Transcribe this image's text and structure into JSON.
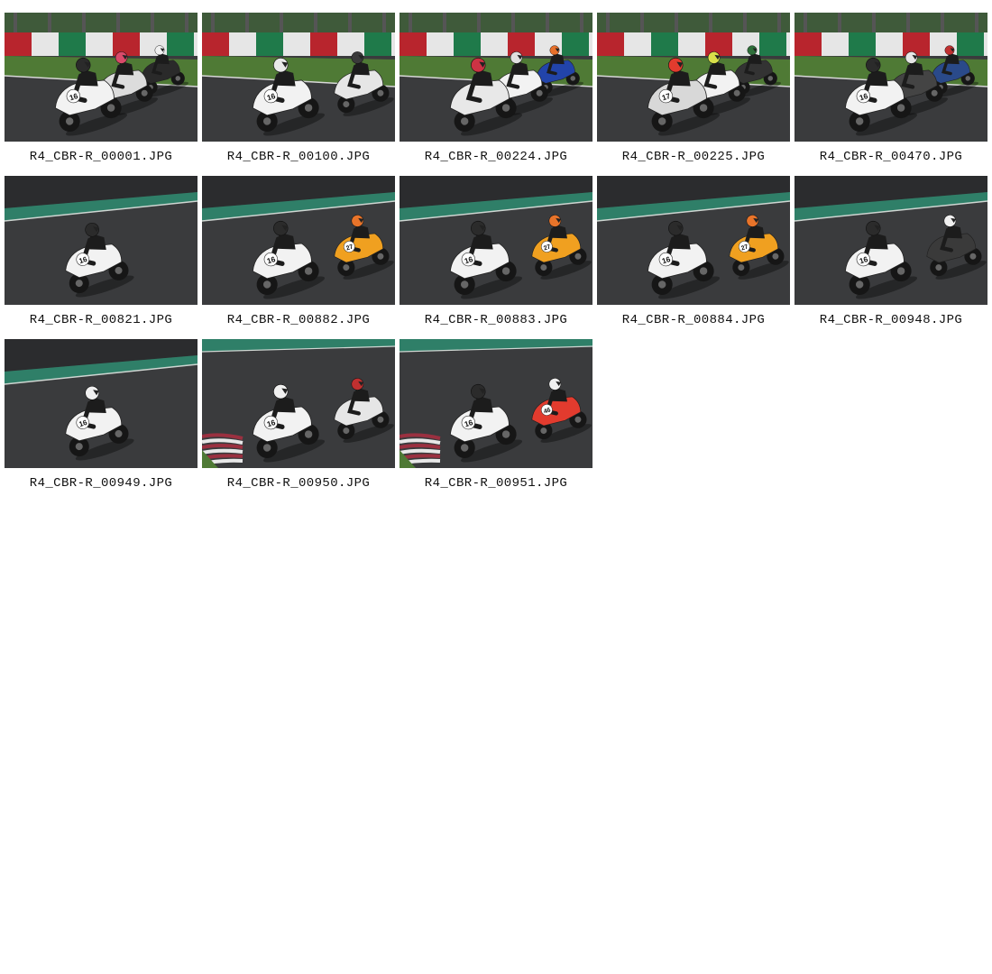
{
  "gallery": {
    "items": [
      {
        "filename": "R4_CBR-R_00001.JPG",
        "scene": "track-wall",
        "riders": [
          {
            "num": "16",
            "bike": "#f2f2f2",
            "helmet": "#2b2b2b",
            "lean": "left"
          },
          {
            "num": "",
            "bike": "#dcdcdc",
            "helmet": "#d94a6a",
            "lean": "left"
          },
          {
            "num": "",
            "bike": "#2a2a2a",
            "helmet": "#f0f0f0",
            "lean": "left"
          }
        ]
      },
      {
        "filename": "R4_CBR-R_00100.JPG",
        "scene": "track-wall",
        "riders": [
          {
            "num": "16",
            "bike": "#f2f2f2",
            "helmet": "#e8e8e8",
            "lean": "left"
          },
          {
            "num": "",
            "bike": "#e6e6e6",
            "helmet": "#3a3a3a",
            "lean": "left"
          }
        ]
      },
      {
        "filename": "R4_CBR-R_00224.JPG",
        "scene": "track-wall",
        "riders": [
          {
            "num": "",
            "bike": "#e8e8e8",
            "helmet": "#cc3344",
            "lean": "left"
          },
          {
            "num": "",
            "bike": "#f2f2f2",
            "helmet": "#e0e0e0",
            "lean": "left"
          },
          {
            "num": "",
            "bike": "#2244aa",
            "helmet": "#e8702a",
            "lean": "left"
          }
        ]
      },
      {
        "filename": "R4_CBR-R_00225.JPG",
        "scene": "track-wall",
        "riders": [
          {
            "num": "17",
            "bike": "#d8d8d8",
            "helmet": "#e23b2e",
            "lean": "left"
          },
          {
            "num": "",
            "bike": "#f2f2f2",
            "helmet": "#d9e04a",
            "lean": "left"
          },
          {
            "num": "",
            "bike": "#333333",
            "helmet": "#2f6f3a",
            "lean": "left"
          }
        ]
      },
      {
        "filename": "R4_CBR-R_00470.JPG",
        "scene": "track-wall",
        "riders": [
          {
            "num": "16",
            "bike": "#f2f2f2",
            "helmet": "#2b2b2b",
            "lean": "left"
          },
          {
            "num": "",
            "bike": "#444444",
            "helmet": "#e6e6e6",
            "lean": "left"
          },
          {
            "num": "",
            "bike": "#2a4a8a",
            "helmet": "#c03030",
            "lean": "left"
          }
        ]
      },
      {
        "filename": "R4_CBR-R_00821.JPG",
        "scene": "track-green",
        "riders": [
          {
            "num": "16",
            "bike": "#f2f2f2",
            "helmet": "#2b2b2b",
            "lean": "left"
          }
        ]
      },
      {
        "filename": "R4_CBR-R_00882.JPG",
        "scene": "track-green",
        "riders": [
          {
            "num": "16",
            "bike": "#f2f2f2",
            "helmet": "#2b2b2b",
            "lean": "left"
          },
          {
            "num": "27",
            "bike": "#f0a020",
            "helmet": "#e8742a",
            "lean": "left"
          }
        ]
      },
      {
        "filename": "R4_CBR-R_00883.JPG",
        "scene": "track-green",
        "riders": [
          {
            "num": "16",
            "bike": "#f2f2f2",
            "helmet": "#2b2b2b",
            "lean": "left"
          },
          {
            "num": "27",
            "bike": "#f0a020",
            "helmet": "#e8742a",
            "lean": "left"
          }
        ]
      },
      {
        "filename": "R4_CBR-R_00884.JPG",
        "scene": "track-green",
        "riders": [
          {
            "num": "16",
            "bike": "#f2f2f2",
            "helmet": "#2b2b2b",
            "lean": "left"
          },
          {
            "num": "27",
            "bike": "#f0a020",
            "helmet": "#e8742a",
            "lean": "left"
          }
        ]
      },
      {
        "filename": "R4_CBR-R_00948.JPG",
        "scene": "track-green",
        "riders": [
          {
            "num": "16",
            "bike": "#f2f2f2",
            "helmet": "#2b2b2b",
            "lean": "left"
          },
          {
            "num": "",
            "bike": "#3a3a3a",
            "helmet": "#f0f0f0",
            "lean": "left"
          }
        ]
      },
      {
        "filename": "R4_CBR-R_00949.JPG",
        "scene": "track-green",
        "riders": [
          {
            "num": "16",
            "bike": "#f2f2f2",
            "helmet": "#f0f0f0",
            "lean": "left"
          }
        ]
      },
      {
        "filename": "R4_CBR-R_00950.JPG",
        "scene": "track-kerb",
        "riders": [
          {
            "num": "16",
            "bike": "#f2f2f2",
            "helmet": "#f0f0f0",
            "lean": "left"
          },
          {
            "num": "",
            "bike": "#e6e6e6",
            "helmet": "#c03030",
            "lean": "left"
          }
        ]
      },
      {
        "filename": "R4_CBR-R_00951.JPG",
        "scene": "track-kerb",
        "riders": [
          {
            "num": "16",
            "bike": "#f2f2f2",
            "helmet": "#2b2b2b",
            "lean": "left"
          },
          {
            "num": "46",
            "bike": "#e23b2e",
            "helmet": "#f0f0f0",
            "lean": "left"
          }
        ]
      }
    ]
  },
  "colors": {
    "background": "#ffffff",
    "caption_text": "#111111",
    "asphalt": "#3a3b3d",
    "grass": "#4f7a35",
    "wall_red": "#b8252d",
    "wall_white": "#e6e6e6",
    "wall_green": "#1f7a4a",
    "trees": "#3f5a3a",
    "green_stripe": "#2f7f68",
    "kerb_red": "#9a3040"
  },
  "icons": {
    "thumbnail": "photo-thumbnail-icon"
  }
}
